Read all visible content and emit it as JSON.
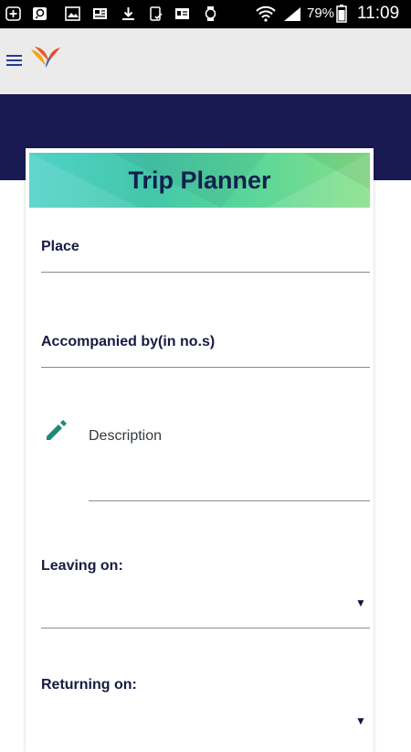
{
  "status_bar": {
    "battery": "79%",
    "time": "11:09",
    "icons": [
      "add-notification-icon",
      "chat-icon",
      "image-icon",
      "news-icon",
      "download-icon",
      "phone-check-icon",
      "card-icon",
      "watch-icon",
      "wifi-icon",
      "signal-icon",
      "battery-icon"
    ]
  },
  "app_bar": {
    "menu_icon": "hamburger-menu-icon",
    "logo_icon": "bird-logo-icon"
  },
  "form": {
    "title": "Trip Planner",
    "place_label": "Place",
    "accompanied_label": "Accompanied by(in no.s)",
    "description_label": "Description",
    "description_icon": "pencil-icon",
    "leaving_label": "Leaving on:",
    "returning_label": "Returning on:",
    "dropdown_arrow": "▼"
  },
  "colors": {
    "header_navy": "#1a1a52",
    "label_navy": "#171b44",
    "pencil_teal": "#1e8a77",
    "banner_start": "#4fd3c9",
    "banner_end": "#86e086"
  }
}
